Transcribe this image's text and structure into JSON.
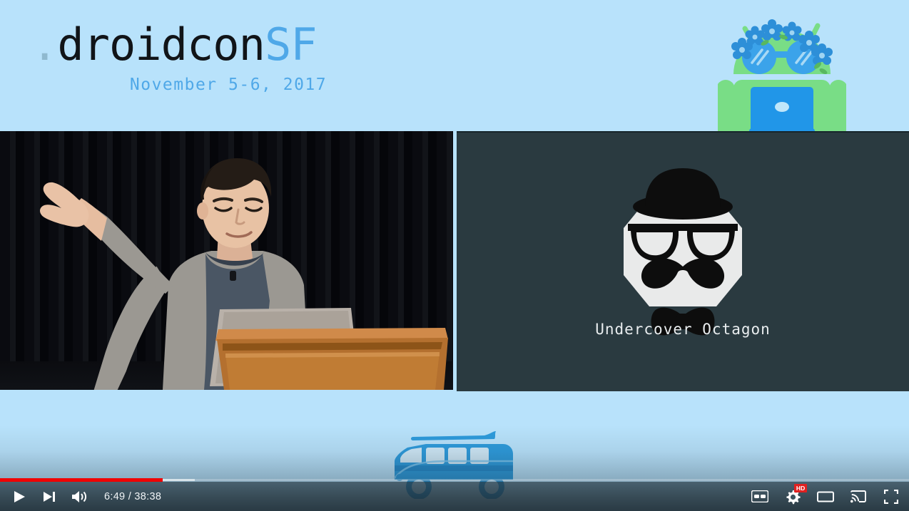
{
  "theme": {
    "slide_bg": "#b8e2fb",
    "accent_blue": "#4fa8e8",
    "title_black": "#111418",
    "slide_panel_bg": "#2a3a40",
    "progress_red": "#f00000",
    "hd_badge_red": "#e02020"
  },
  "header": {
    "dot": ".",
    "title_main": "droidcon",
    "title_accent": "SF",
    "date": "November 5-6, 2017",
    "mascot_icon": "android-robot-flower-crown-icon"
  },
  "video": {
    "camera_panel": {
      "label": "speaker-camera-feed",
      "description": "speaker-at-podium"
    },
    "slide_panel": {
      "caption": "Undercover Octagon",
      "mascot_icon": "octagon-face-bowler-hat-icon"
    },
    "footer_graphic": "vw-van-surfboard-icon"
  },
  "player": {
    "current_time": "6:49",
    "duration": "38:38",
    "timecode": "6:49 / 38:38",
    "progress_played_pct": 17.9,
    "progress_loaded_pct": 21.4,
    "controls": {
      "play": "play-button",
      "next": "next-video-button",
      "volume": "volume-button",
      "captions": "CC",
      "settings": "settings-gear-button",
      "quality_badge": "HD",
      "theater": "theater-mode-button",
      "cast": "cast-button",
      "fullscreen": "fullscreen-button"
    }
  }
}
